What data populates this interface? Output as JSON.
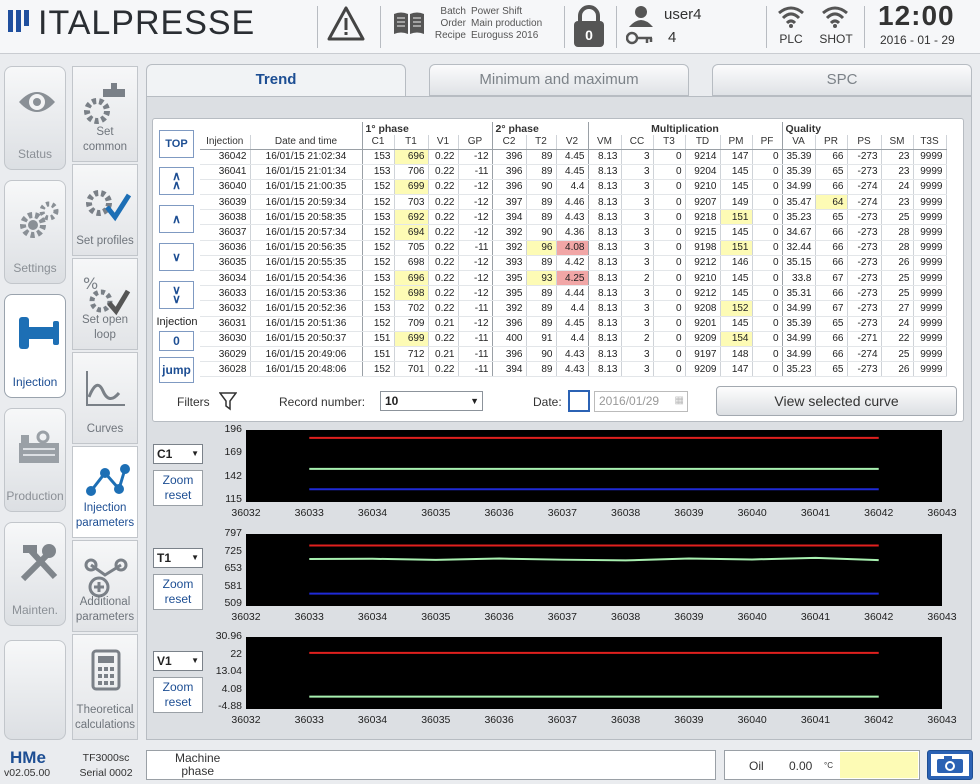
{
  "header": {
    "brand": "ITALPRESSE",
    "batch_label": "Batch",
    "order_label": "Order",
    "recipe_label": "Recipe",
    "batch_value": "Power Shift",
    "order_value": "Main production",
    "recipe_value": "Euroguss 2016",
    "lock_count": "0",
    "user": "user4",
    "user_level": "4",
    "plc_label": "PLC",
    "shot_label": "SHOT",
    "time": "12:00",
    "date": "2016 - 01 - 29"
  },
  "nav": [
    {
      "label": "Status",
      "icon": "eye-icon"
    },
    {
      "label": "Settings",
      "icon": "gears-icon"
    },
    {
      "label": "Injection",
      "icon": "injection-icon"
    },
    {
      "label": "Production",
      "icon": "factory-icon"
    },
    {
      "label": "Mainten.",
      "icon": "tools-icon"
    }
  ],
  "subnav": [
    {
      "label1": "Set",
      "label2": "common",
      "icon": "valve-gear-icon"
    },
    {
      "label1": "Set profiles",
      "label2": "",
      "icon": "gear-check-icon"
    },
    {
      "label1": "Set open",
      "label2": "loop",
      "icon": "percent-gear-icon"
    },
    {
      "label1": "Curves",
      "label2": "",
      "icon": "curve-icon"
    },
    {
      "label1": "Injection",
      "label2": "parameters",
      "icon": "network-icon"
    },
    {
      "label1": "Additional",
      "label2": "parameters",
      "icon": "network-plus-icon"
    },
    {
      "label1": "Theoretical",
      "label2": "calculations",
      "icon": "calculator-icon"
    }
  ],
  "tabs": [
    "Trend",
    "Minimum and maximum",
    "SPC"
  ],
  "table": {
    "groups": {
      "phase1": "1° phase",
      "phase2": "2° phase",
      "mult": "Multiplication",
      "quality": "Quality"
    },
    "columns": [
      "Injection",
      "Date and time",
      "C1",
      "T1",
      "V1",
      "GP",
      "C2",
      "T2",
      "V2",
      "VM",
      "CC",
      "T3",
      "TD",
      "PM",
      "PF",
      "VA",
      "PR",
      "PS",
      "SM",
      "T3S"
    ],
    "rows": [
      [
        "36042",
        "16/01/15 21:02:34",
        "153",
        "696",
        "0.22",
        "-12",
        "396",
        "89",
        "4.45",
        "8.13",
        "3",
        "0",
        "9214",
        "147",
        "0",
        "35.39",
        "66",
        "-273",
        "23",
        "9999"
      ],
      [
        "36041",
        "16/01/15 21:01:34",
        "153",
        "706",
        "0.22",
        "-11",
        "396",
        "89",
        "4.45",
        "8.13",
        "3",
        "0",
        "9204",
        "145",
        "0",
        "35.39",
        "65",
        "-273",
        "23",
        "9999"
      ],
      [
        "36040",
        "16/01/15 21:00:35",
        "152",
        "699",
        "0.22",
        "-12",
        "396",
        "90",
        "4.4",
        "8.13",
        "3",
        "0",
        "9210",
        "145",
        "0",
        "34.99",
        "66",
        "-274",
        "24",
        "9999"
      ],
      [
        "36039",
        "16/01/15 20:59:34",
        "152",
        "703",
        "0.22",
        "-12",
        "397",
        "89",
        "4.46",
        "8.13",
        "3",
        "0",
        "9207",
        "149",
        "0",
        "35.47",
        "64",
        "-274",
        "23",
        "9999"
      ],
      [
        "36038",
        "16/01/15 20:58:35",
        "153",
        "692",
        "0.22",
        "-12",
        "394",
        "89",
        "4.43",
        "8.13",
        "3",
        "0",
        "9218",
        "151",
        "0",
        "35.23",
        "65",
        "-273",
        "25",
        "9999"
      ],
      [
        "36037",
        "16/01/15 20:57:34",
        "152",
        "694",
        "0.22",
        "-12",
        "392",
        "90",
        "4.36",
        "8.13",
        "3",
        "0",
        "9215",
        "145",
        "0",
        "34.67",
        "66",
        "-273",
        "28",
        "9999"
      ],
      [
        "36036",
        "16/01/15 20:56:35",
        "152",
        "705",
        "0.22",
        "-11",
        "392",
        "96",
        "4.08",
        "8.13",
        "3",
        "0",
        "9198",
        "151",
        "0",
        "32.44",
        "66",
        "-273",
        "28",
        "9999"
      ],
      [
        "36035",
        "16/01/15 20:55:35",
        "152",
        "698",
        "0.22",
        "-12",
        "393",
        "89",
        "4.42",
        "8.13",
        "3",
        "0",
        "9212",
        "146",
        "0",
        "35.15",
        "66",
        "-273",
        "26",
        "9999"
      ],
      [
        "36034",
        "16/01/15 20:54:36",
        "153",
        "696",
        "0.22",
        "-12",
        "395",
        "93",
        "4.25",
        "8.13",
        "2",
        "0",
        "9210",
        "145",
        "0",
        "33.8",
        "67",
        "-273",
        "25",
        "9999"
      ],
      [
        "36033",
        "16/01/15 20:53:36",
        "152",
        "698",
        "0.22",
        "-12",
        "395",
        "89",
        "4.44",
        "8.13",
        "3",
        "0",
        "9212",
        "145",
        "0",
        "35.31",
        "66",
        "-273",
        "25",
        "9999"
      ],
      [
        "36032",
        "16/01/15 20:52:36",
        "153",
        "702",
        "0.22",
        "-11",
        "392",
        "89",
        "4.4",
        "8.13",
        "3",
        "0",
        "9208",
        "152",
        "0",
        "34.99",
        "67",
        "-273",
        "27",
        "9999"
      ],
      [
        "36031",
        "16/01/15 20:51:36",
        "152",
        "709",
        "0.21",
        "-12",
        "396",
        "89",
        "4.45",
        "8.13",
        "3",
        "0",
        "9201",
        "145",
        "0",
        "35.39",
        "65",
        "-273",
        "24",
        "9999"
      ],
      [
        "36030",
        "16/01/15 20:50:37",
        "151",
        "699",
        "0.22",
        "-11",
        "400",
        "91",
        "4.4",
        "8.13",
        "2",
        "0",
        "9209",
        "154",
        "0",
        "34.99",
        "66",
        "-271",
        "22",
        "9999"
      ],
      [
        "36029",
        "16/01/15 20:49:06",
        "151",
        "712",
        "0.21",
        "-11",
        "396",
        "90",
        "4.43",
        "8.13",
        "3",
        "0",
        "9197",
        "148",
        "0",
        "34.99",
        "66",
        "-274",
        "25",
        "9999"
      ],
      [
        "36028",
        "16/01/15 20:48:06",
        "152",
        "701",
        "0.22",
        "-11",
        "394",
        "89",
        "4.43",
        "8.13",
        "3",
        "0",
        "9209",
        "147",
        "0",
        "35.23",
        "65",
        "-273",
        "26",
        "9999"
      ]
    ],
    "highlights_yellow": [
      [
        0,
        3
      ],
      [
        2,
        3
      ],
      [
        4,
        3
      ],
      [
        5,
        3
      ],
      [
        8,
        3
      ],
      [
        9,
        3
      ],
      [
        12,
        3
      ],
      [
        6,
        7
      ],
      [
        8,
        7
      ],
      [
        4,
        13
      ],
      [
        6,
        13
      ],
      [
        10,
        13
      ],
      [
        12,
        13
      ],
      [
        3,
        16
      ]
    ],
    "highlights_red": [
      [
        6,
        8
      ],
      [
        8,
        8
      ]
    ]
  },
  "controls": {
    "top": "TOP",
    "injection_label": "Injection",
    "injection_value": "0",
    "jump": "jump",
    "filters": "Filters",
    "record_label": "Record number:",
    "record_value": "10",
    "date_label": "Date:",
    "date_value": "2016/01/29",
    "view_button": "View selected curve"
  },
  "chart_data": [
    {
      "type": "line",
      "select": "C1",
      "zoom": "Zoom reset",
      "yticks": [
        "196",
        "169",
        "142",
        "115"
      ],
      "ylim": [
        115,
        196
      ],
      "x": [
        36032,
        36033,
        36034,
        36035,
        36036,
        36037,
        36038,
        36039,
        36040,
        36041,
        36042,
        36043
      ],
      "xticks": [
        "36032",
        "36033",
        "36034",
        "36035",
        "36036",
        "36037",
        "36038",
        "36039",
        "36040",
        "36041",
        "36042",
        "36043"
      ],
      "series": [
        {
          "color": "#e0201e",
          "x": [
            36033,
            36042
          ],
          "values": [
            190,
            190
          ]
        },
        {
          "color": "#a8f0b0",
          "x": [
            36033,
            36042
          ],
          "values": [
            152,
            152
          ]
        },
        {
          "color": "#1f2ad6",
          "x": [
            36033,
            36042
          ],
          "values": [
            127,
            127
          ]
        }
      ]
    },
    {
      "type": "line",
      "select": "T1",
      "zoom": "Zoom reset",
      "yticks": [
        "797",
        "725",
        "653",
        "581",
        "509"
      ],
      "ylim": [
        509,
        797
      ],
      "x": [
        36032,
        36043
      ],
      "xticks": [
        "36032",
        "36033",
        "36034",
        "36035",
        "36036",
        "36037",
        "36038",
        "36039",
        "36040",
        "36041",
        "36042",
        "36043"
      ],
      "series": [
        {
          "color": "#e0201e",
          "x": [
            36033,
            36042
          ],
          "values": [
            760,
            760
          ]
        },
        {
          "color": "#a8f0b0",
          "x": [
            36033,
            36034,
            36035,
            36036,
            36037,
            36038,
            36039,
            36040,
            36041,
            36042
          ],
          "values": [
            701,
            702,
            697,
            703,
            698,
            695,
            703,
            699,
            706,
            696
          ]
        },
        {
          "color": "#1f2ad6",
          "x": [
            36033,
            36042
          ],
          "values": [
            550,
            550
          ]
        }
      ]
    },
    {
      "type": "line",
      "select": "V1",
      "zoom": "Zoom reset",
      "yticks": [
        "30.96",
        "22",
        "13.04",
        "4.08",
        "-4.88"
      ],
      "ylim": [
        -4.88,
        30.96
      ],
      "x": [
        36032,
        36043
      ],
      "xticks": [
        "36032",
        "36033",
        "36034",
        "36035",
        "36036",
        "36037",
        "36038",
        "36039",
        "36040",
        "36041",
        "36042",
        "36043"
      ],
      "series": [
        {
          "color": "#e0201e",
          "x": [
            36033,
            36042
          ],
          "values": [
            24,
            24
          ]
        },
        {
          "color": "#a8f0b0",
          "x": [
            36033,
            36042
          ],
          "values": [
            0.22,
            0.22
          ]
        }
      ]
    }
  ],
  "footer": {
    "logo": "HMe",
    "version": "v02.05.00",
    "model": "TF3000sc",
    "serial": "Serial 0002",
    "machine_phase": "Machine\nphase",
    "oil_label": "Oil",
    "oil_value": "0.00",
    "oil_unit": "°C"
  }
}
